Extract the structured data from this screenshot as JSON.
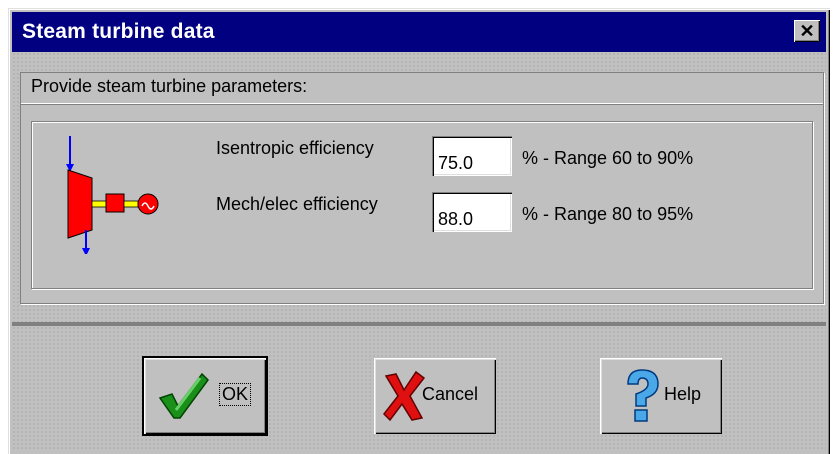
{
  "window": {
    "title": "Steam turbine data",
    "close_glyph": "✕"
  },
  "group": {
    "label": "Provide steam turbine parameters:"
  },
  "params": [
    {
      "label": "Isentropic efficiency",
      "value": "75.0",
      "range": "% - Range 60 to 90%"
    },
    {
      "label": "Mech/elec efficiency",
      "value": "88.0",
      "range": "% - Range 80 to 95%"
    }
  ],
  "buttons": {
    "ok": {
      "label": "OK",
      "icon": "checkmark-icon"
    },
    "cancel": {
      "label": "Cancel",
      "icon": "red-x-icon"
    },
    "help": {
      "label": "Help",
      "icon": "question-mark-icon"
    }
  },
  "colors": {
    "titlebar": "#000080",
    "dialog_face": "#c0c0c0",
    "turbine_red": "#ff0000",
    "flow_blue": "#0000ff"
  }
}
